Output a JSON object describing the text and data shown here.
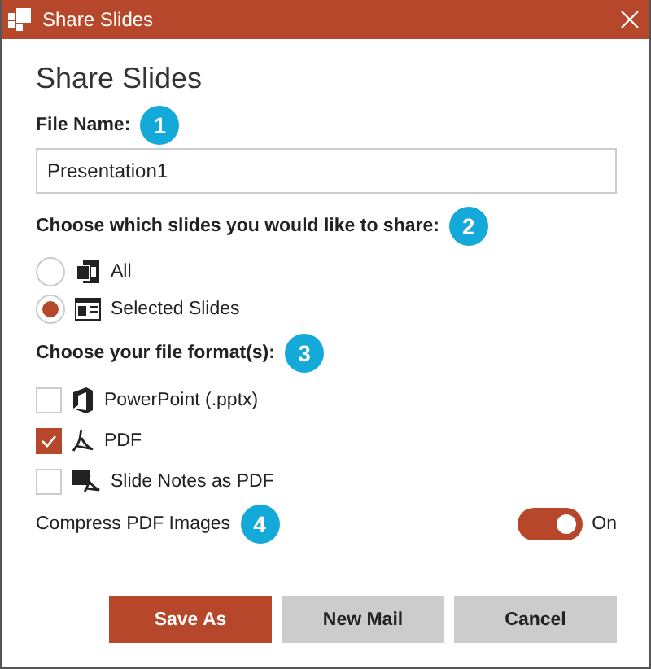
{
  "window": {
    "title": "Share Slides"
  },
  "heading": "Share Slides",
  "file_name": {
    "label": "File Name:",
    "badge": "1",
    "value": "Presentation1"
  },
  "slides": {
    "label": "Choose which slides you would like to share:",
    "badge": "2",
    "options": [
      {
        "label": "All",
        "selected": false
      },
      {
        "label": "Selected Slides",
        "selected": true
      }
    ]
  },
  "formats": {
    "label": "Choose your file format(s):",
    "badge": "3",
    "options": [
      {
        "label": "PowerPoint (.pptx)",
        "checked": false
      },
      {
        "label": "PDF",
        "checked": true
      },
      {
        "label": "Slide Notes as PDF",
        "checked": false
      }
    ]
  },
  "compress": {
    "label": "Compress PDF Images",
    "badge": "4",
    "on": true,
    "state": "On"
  },
  "buttons": [
    {
      "label": "Save As",
      "kind": "primary"
    },
    {
      "label": "New Mail",
      "kind": "secondary"
    },
    {
      "label": "Cancel",
      "kind": "secondary"
    }
  ]
}
